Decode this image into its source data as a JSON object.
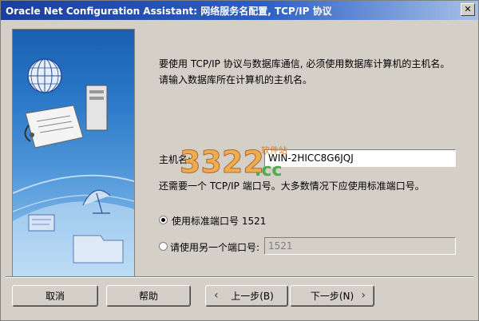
{
  "window": {
    "title": "Oracle Net Configuration Assistant: 网络服务名配置, TCP/IP 协议",
    "close_glyph": "✕"
  },
  "content": {
    "intro_line1": "要使用 TCP/IP 协议与数据库通信, 必须使用数据库计算机的主机名。",
    "intro_line2": "请输入数据库所在计算机的主机名。",
    "hostname_label": "主机名:",
    "hostname_value": "WIN-2HICC8G6JQJ",
    "port_note": "还需要一个 TCP/IP 端口号。大多数情况下应使用标准端口号。",
    "radio_standard_label": "使用标准端口号 1521",
    "radio_standard_checked": true,
    "radio_other_label": "请使用另一个端口号:",
    "radio_other_checked": false,
    "other_port_value": "1521"
  },
  "buttons": {
    "cancel": "取消",
    "help": "帮助",
    "back": "上一步(B)",
    "next": "下一步(N)"
  },
  "watermark": {
    "text_main": "3322",
    "text_cc": ".cc",
    "text_small": "软件站"
  },
  "icons": {
    "art": "network-globe-document-illustration",
    "back_arrow": "chevron-left-icon",
    "next_arrow": "chevron-right-icon"
  }
}
